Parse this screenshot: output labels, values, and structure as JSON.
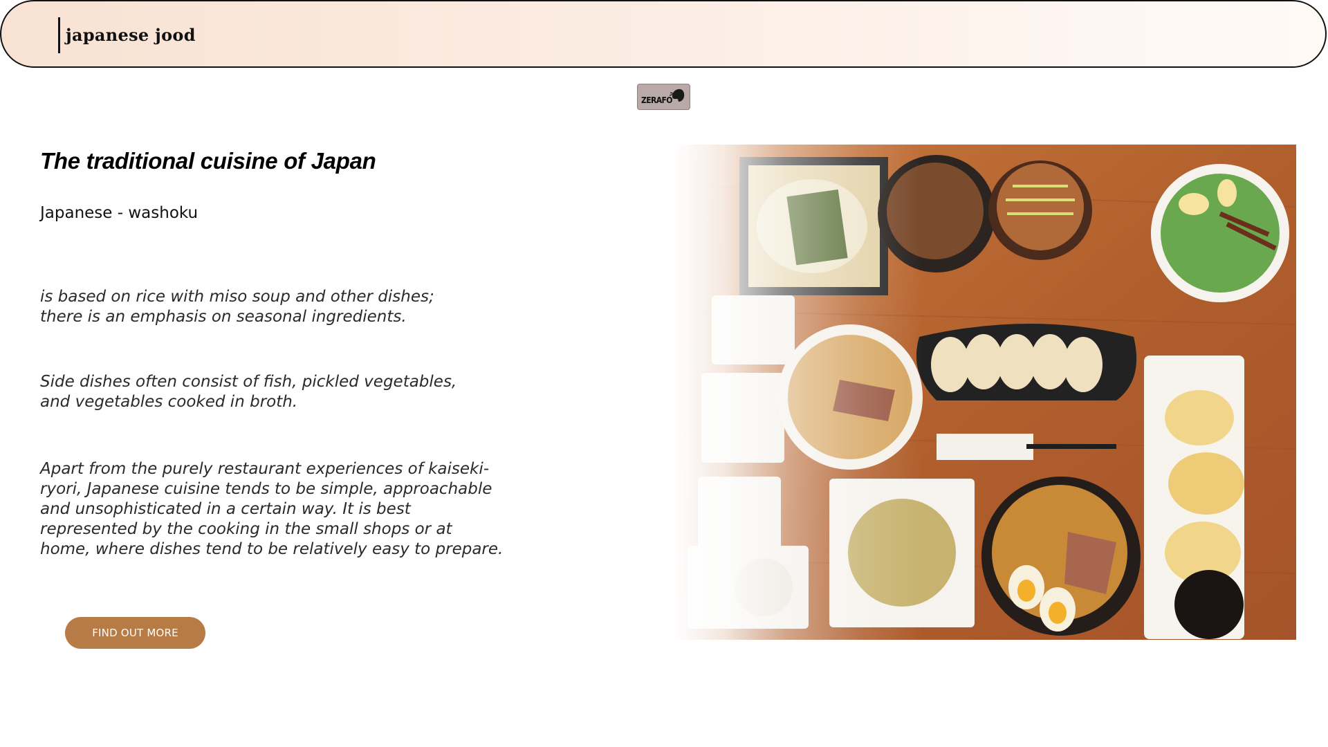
{
  "header": {
    "brand": "japanese jood"
  },
  "logo_badge": {
    "text": "ZERAFO"
  },
  "hero": {
    "title": "The traditional cuisine of Japan",
    "subtitle": "Japanese - washoku",
    "paragraphs": [
      "is based on rice with miso soup and other dishes;\nthere is an emphasis on seasonal ingredients.",
      "Side dishes often consist of fish, pickled vegetables,\nand vegetables cooked in broth.",
      "Apart from the purely restaurant experiences of kaiseki-\nryori, Japanese cuisine tends to be simple, approachable\nand unsophisticated in a certain way. It is best\nrepresented by the cooking in the small shops or at\nhome, where dishes tend to be relatively easy to prepare."
    ],
    "cta_label": "FIND OUT MORE"
  },
  "colors": {
    "header_border": "#111111",
    "header_gradient_start": "#f8e2d3",
    "cta_background": "#b77c45",
    "table_wood": "#b6622f"
  },
  "image": {
    "subject": "overhead view of Japanese dishes on a wooden table"
  }
}
